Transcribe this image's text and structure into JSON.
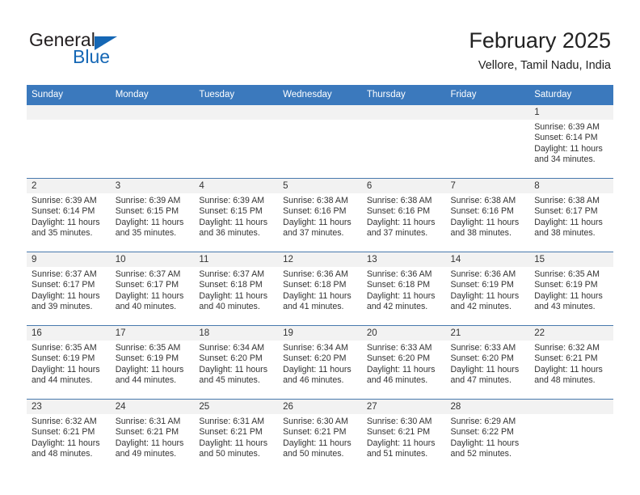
{
  "brand": {
    "name_part1": "General",
    "name_part2": "Blue",
    "accent_color": "#1567b5"
  },
  "header": {
    "title": "February 2025",
    "subtitle": "Vellore, Tamil Nadu, India"
  },
  "theme": {
    "header_blue": "#3b79bd",
    "daynum_bg": "#f2f2f2",
    "row_divider": "#4879ad"
  },
  "weekdays": [
    "Sunday",
    "Monday",
    "Tuesday",
    "Wednesday",
    "Thursday",
    "Friday",
    "Saturday"
  ],
  "labels": {
    "sunrise_prefix": "Sunrise:",
    "sunset_prefix": "Sunset:",
    "daylight_prefix": "Daylight:"
  },
  "weeks": [
    [
      {
        "day": "",
        "blank": true
      },
      {
        "day": "",
        "blank": true
      },
      {
        "day": "",
        "blank": true
      },
      {
        "day": "",
        "blank": true
      },
      {
        "day": "",
        "blank": true
      },
      {
        "day": "",
        "blank": true
      },
      {
        "day": "1",
        "sunrise": "Sunrise: 6:39 AM",
        "sunset": "Sunset: 6:14 PM",
        "daylight": "Daylight: 11 hours and 34 minutes."
      }
    ],
    [
      {
        "day": "2",
        "sunrise": "Sunrise: 6:39 AM",
        "sunset": "Sunset: 6:14 PM",
        "daylight": "Daylight: 11 hours and 35 minutes."
      },
      {
        "day": "3",
        "sunrise": "Sunrise: 6:39 AM",
        "sunset": "Sunset: 6:15 PM",
        "daylight": "Daylight: 11 hours and 35 minutes."
      },
      {
        "day": "4",
        "sunrise": "Sunrise: 6:39 AM",
        "sunset": "Sunset: 6:15 PM",
        "daylight": "Daylight: 11 hours and 36 minutes."
      },
      {
        "day": "5",
        "sunrise": "Sunrise: 6:38 AM",
        "sunset": "Sunset: 6:16 PM",
        "daylight": "Daylight: 11 hours and 37 minutes."
      },
      {
        "day": "6",
        "sunrise": "Sunrise: 6:38 AM",
        "sunset": "Sunset: 6:16 PM",
        "daylight": "Daylight: 11 hours and 37 minutes."
      },
      {
        "day": "7",
        "sunrise": "Sunrise: 6:38 AM",
        "sunset": "Sunset: 6:16 PM",
        "daylight": "Daylight: 11 hours and 38 minutes."
      },
      {
        "day": "8",
        "sunrise": "Sunrise: 6:38 AM",
        "sunset": "Sunset: 6:17 PM",
        "daylight": "Daylight: 11 hours and 38 minutes."
      }
    ],
    [
      {
        "day": "9",
        "sunrise": "Sunrise: 6:37 AM",
        "sunset": "Sunset: 6:17 PM",
        "daylight": "Daylight: 11 hours and 39 minutes."
      },
      {
        "day": "10",
        "sunrise": "Sunrise: 6:37 AM",
        "sunset": "Sunset: 6:17 PM",
        "daylight": "Daylight: 11 hours and 40 minutes."
      },
      {
        "day": "11",
        "sunrise": "Sunrise: 6:37 AM",
        "sunset": "Sunset: 6:18 PM",
        "daylight": "Daylight: 11 hours and 40 minutes."
      },
      {
        "day": "12",
        "sunrise": "Sunrise: 6:36 AM",
        "sunset": "Sunset: 6:18 PM",
        "daylight": "Daylight: 11 hours and 41 minutes."
      },
      {
        "day": "13",
        "sunrise": "Sunrise: 6:36 AM",
        "sunset": "Sunset: 6:18 PM",
        "daylight": "Daylight: 11 hours and 42 minutes."
      },
      {
        "day": "14",
        "sunrise": "Sunrise: 6:36 AM",
        "sunset": "Sunset: 6:19 PM",
        "daylight": "Daylight: 11 hours and 42 minutes."
      },
      {
        "day": "15",
        "sunrise": "Sunrise: 6:35 AM",
        "sunset": "Sunset: 6:19 PM",
        "daylight": "Daylight: 11 hours and 43 minutes."
      }
    ],
    [
      {
        "day": "16",
        "sunrise": "Sunrise: 6:35 AM",
        "sunset": "Sunset: 6:19 PM",
        "daylight": "Daylight: 11 hours and 44 minutes."
      },
      {
        "day": "17",
        "sunrise": "Sunrise: 6:35 AM",
        "sunset": "Sunset: 6:19 PM",
        "daylight": "Daylight: 11 hours and 44 minutes."
      },
      {
        "day": "18",
        "sunrise": "Sunrise: 6:34 AM",
        "sunset": "Sunset: 6:20 PM",
        "daylight": "Daylight: 11 hours and 45 minutes."
      },
      {
        "day": "19",
        "sunrise": "Sunrise: 6:34 AM",
        "sunset": "Sunset: 6:20 PM",
        "daylight": "Daylight: 11 hours and 46 minutes."
      },
      {
        "day": "20",
        "sunrise": "Sunrise: 6:33 AM",
        "sunset": "Sunset: 6:20 PM",
        "daylight": "Daylight: 11 hours and 46 minutes."
      },
      {
        "day": "21",
        "sunrise": "Sunrise: 6:33 AM",
        "sunset": "Sunset: 6:20 PM",
        "daylight": "Daylight: 11 hours and 47 minutes."
      },
      {
        "day": "22",
        "sunrise": "Sunrise: 6:32 AM",
        "sunset": "Sunset: 6:21 PM",
        "daylight": "Daylight: 11 hours and 48 minutes."
      }
    ],
    [
      {
        "day": "23",
        "sunrise": "Sunrise: 6:32 AM",
        "sunset": "Sunset: 6:21 PM",
        "daylight": "Daylight: 11 hours and 48 minutes."
      },
      {
        "day": "24",
        "sunrise": "Sunrise: 6:31 AM",
        "sunset": "Sunset: 6:21 PM",
        "daylight": "Daylight: 11 hours and 49 minutes."
      },
      {
        "day": "25",
        "sunrise": "Sunrise: 6:31 AM",
        "sunset": "Sunset: 6:21 PM",
        "daylight": "Daylight: 11 hours and 50 minutes."
      },
      {
        "day": "26",
        "sunrise": "Sunrise: 6:30 AM",
        "sunset": "Sunset: 6:21 PM",
        "daylight": "Daylight: 11 hours and 50 minutes."
      },
      {
        "day": "27",
        "sunrise": "Sunrise: 6:30 AM",
        "sunset": "Sunset: 6:21 PM",
        "daylight": "Daylight: 11 hours and 51 minutes."
      },
      {
        "day": "28",
        "sunrise": "Sunrise: 6:29 AM",
        "sunset": "Sunset: 6:22 PM",
        "daylight": "Daylight: 11 hours and 52 minutes."
      },
      {
        "day": "",
        "blank": true
      }
    ]
  ]
}
